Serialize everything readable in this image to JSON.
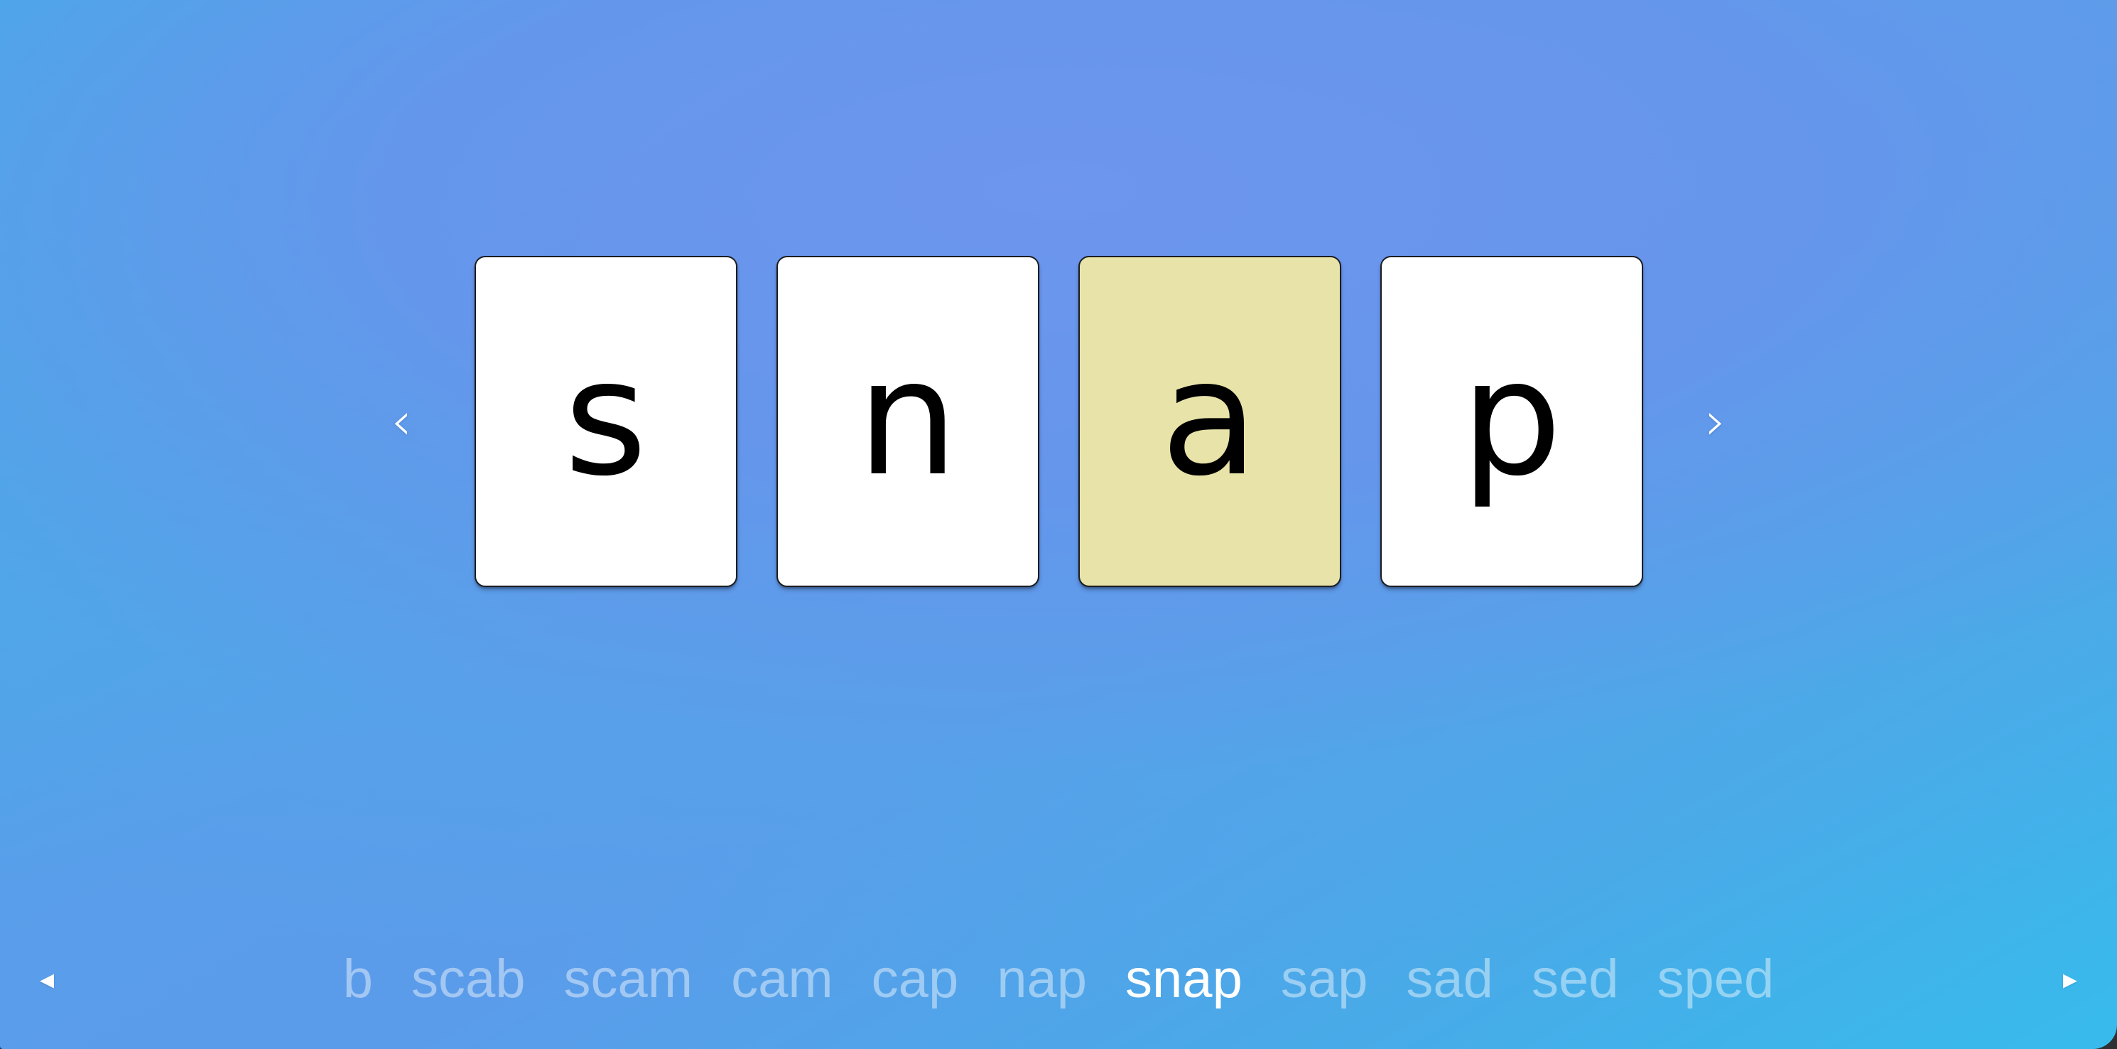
{
  "theme": {
    "background_gradient_from": "#3bb0e9",
    "background_gradient_mid": "#6296ea",
    "background_gradient_to": "#37bbec",
    "card_background": "#ffffff",
    "card_highlight_background": "#e8e3a8",
    "card_border": "#1b1d22",
    "letter_color": "#000000",
    "active_word_color": "#ffffff",
    "inactive_word_color": "rgba(255,255,255,0.44)"
  },
  "word_builder": {
    "prev_letter_arrow": "‹",
    "next_letter_arrow": "›",
    "current_word": "snap",
    "cards": [
      {
        "letter": "s",
        "highlighted": false
      },
      {
        "letter": "n",
        "highlighted": false
      },
      {
        "letter": "a",
        "highlighted": true
      },
      {
        "letter": "p",
        "highlighted": false
      }
    ]
  },
  "word_strip": {
    "prev_arrow": "◂",
    "next_arrow": "▸",
    "active_word": "snap",
    "words": [
      {
        "label": "b",
        "active": false
      },
      {
        "label": "scab",
        "active": false
      },
      {
        "label": "scam",
        "active": false
      },
      {
        "label": "cam",
        "active": false
      },
      {
        "label": "cap",
        "active": false
      },
      {
        "label": "nap",
        "active": false
      },
      {
        "label": "snap",
        "active": true
      },
      {
        "label": "sap",
        "active": false
      },
      {
        "label": "sad",
        "active": false
      },
      {
        "label": "sed",
        "active": false
      },
      {
        "label": "sped",
        "active": false
      }
    ]
  }
}
